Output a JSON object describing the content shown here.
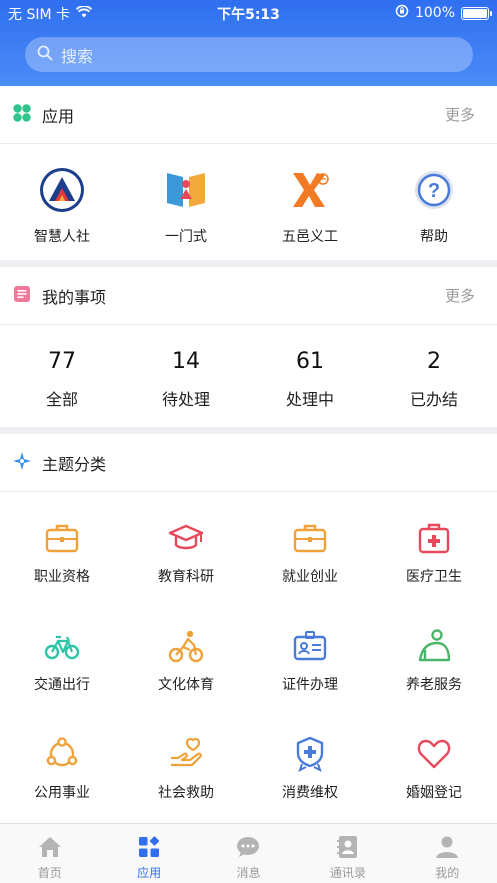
{
  "status_bar": {
    "carrier": "无 SIM 卡",
    "time": "下午5:13",
    "battery_text": "100%",
    "battery_level": 1.0
  },
  "search": {
    "placeholder": "搜索"
  },
  "apps_section": {
    "title": "应用",
    "more": "更多",
    "items": [
      {
        "label": "智慧人社",
        "icon": "people-logo-icon"
      },
      {
        "label": "一门式",
        "icon": "gate-logo-icon"
      },
      {
        "label": "五邑义工",
        "icon": "volunteer-logo-icon"
      },
      {
        "label": "帮助",
        "icon": "help-icon"
      }
    ]
  },
  "tasks_section": {
    "title": "我的事项",
    "more": "更多",
    "items": [
      {
        "count": "77",
        "label": "全部"
      },
      {
        "count": "14",
        "label": "待处理"
      },
      {
        "count": "61",
        "label": "处理中"
      },
      {
        "count": "2",
        "label": "已办结"
      }
    ]
  },
  "topics_section": {
    "title": "主题分类",
    "items": [
      {
        "label": "职业资格",
        "icon": "briefcase-icon",
        "color": "#f0a23a"
      },
      {
        "label": "教育科研",
        "icon": "graduation-cap-icon",
        "color": "#e8495a"
      },
      {
        "label": "就业创业",
        "icon": "briefcase-icon",
        "color": "#f0a23a"
      },
      {
        "label": "医疗卫生",
        "icon": "medical-kit-icon",
        "color": "#e8495a"
      },
      {
        "label": "交通出行",
        "icon": "bicycle-icon",
        "color": "#2ec4a6"
      },
      {
        "label": "文化体育",
        "icon": "cyclist-icon",
        "color": "#f0a23a"
      },
      {
        "label": "证件办理",
        "icon": "id-card-icon",
        "color": "#4a7bd9"
      },
      {
        "label": "养老服务",
        "icon": "elderly-icon",
        "color": "#4cb56a"
      },
      {
        "label": "公用事业",
        "icon": "network-icon",
        "color": "#f0a23a"
      },
      {
        "label": "社会救助",
        "icon": "helping-hand-icon",
        "color": "#f0a23a"
      },
      {
        "label": "消费维权",
        "icon": "shield-badge-icon",
        "color": "#4a7bd9"
      },
      {
        "label": "婚姻登记",
        "icon": "heart-icon",
        "color": "#e8495a"
      }
    ]
  },
  "tabbar": {
    "items": [
      {
        "label": "首页",
        "icon": "home-icon",
        "active": false
      },
      {
        "label": "应用",
        "icon": "apps-icon",
        "active": true
      },
      {
        "label": "消息",
        "icon": "message-icon",
        "active": false
      },
      {
        "label": "通讯录",
        "icon": "contacts-icon",
        "active": false
      },
      {
        "label": "我的",
        "icon": "profile-icon",
        "active": false
      }
    ]
  }
}
